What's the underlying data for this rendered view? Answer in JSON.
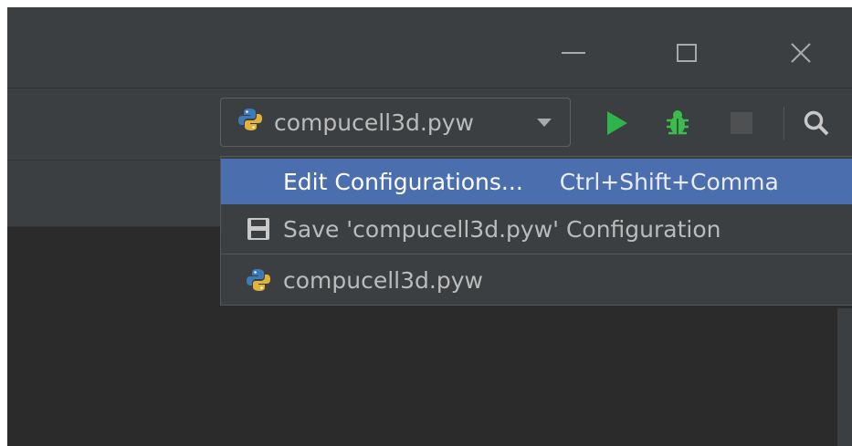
{
  "title_bar": {
    "buttons": [
      {
        "name": "minimize",
        "icon": "minimize-icon"
      },
      {
        "name": "maximize",
        "icon": "maximize-icon"
      },
      {
        "name": "close",
        "icon": "close-icon",
        "glyph": "✕"
      }
    ]
  },
  "toolbar": {
    "run_config": {
      "label": "compucell3d.pyw",
      "icon": "python-icon"
    },
    "actions": [
      {
        "name": "run",
        "icon": "play-icon",
        "color": "#2fb34c"
      },
      {
        "name": "debug",
        "icon": "bug-icon",
        "color": "#3dbb4f"
      },
      {
        "name": "stop",
        "icon": "stop-icon",
        "color": "#4f5052"
      },
      {
        "name": "search",
        "icon": "search-icon",
        "color": "#c8c8c8"
      }
    ]
  },
  "dropdown": {
    "items": [
      {
        "label": "Edit Configurations...",
        "shortcut": "Ctrl+Shift+Comma",
        "selected": true
      },
      {
        "label": "Save 'compucell3d.pyw' Configuration",
        "icon": "save-icon"
      },
      {
        "label": "compucell3d.pyw",
        "icon": "python-icon"
      }
    ]
  },
  "colors": {
    "selection": "#4b6eaf",
    "background": "#2b2b2b",
    "panel": "#3c3f41",
    "text": "#bbbbbb"
  }
}
